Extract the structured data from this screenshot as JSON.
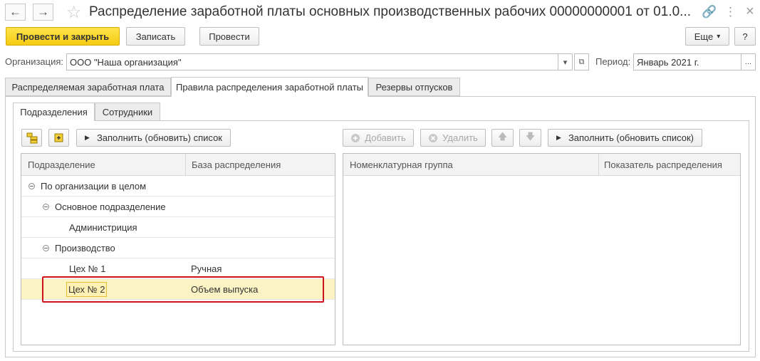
{
  "window": {
    "title": "Распределение заработной платы основных производственных рабочих 00000000001 от 01.0...",
    "back_icon": "←",
    "forward_icon": "→",
    "star_icon": "☆",
    "link_icon": "🔗",
    "more_icon": "⋮",
    "close_icon": "×"
  },
  "toolbar": {
    "post_close": "Провести и закрыть",
    "save": "Записать",
    "post": "Провести",
    "more": "Еще",
    "more_arrow": "▾",
    "help": "?"
  },
  "organization": {
    "label": "Организация:",
    "value": "ООО \"Наша организация\"",
    "dropdown": "▾",
    "open_icon": "⧉"
  },
  "period": {
    "label": "Период:",
    "value": "Январь 2021 г.",
    "select": "..."
  },
  "tabs": [
    "Распределяемая заработная плата",
    "Правила распределения заработной платы",
    "Резервы отпусков"
  ],
  "subtabs": [
    "Подразделения",
    "Сотрудники"
  ],
  "left_panel": {
    "fill_button": "Заполнить (обновить) список",
    "columns": [
      "Подразделение",
      "База распределения"
    ],
    "rows": [
      {
        "name": "По организации в целом",
        "base": ""
      },
      {
        "name": "Основное подразделение",
        "base": ""
      },
      {
        "name": "Администриция",
        "base": ""
      },
      {
        "name": "Производство",
        "base": ""
      },
      {
        "name": "Цех № 1",
        "base": "Ручная"
      },
      {
        "name": "Цех № 2",
        "base": "Объем выпуска"
      }
    ]
  },
  "right_panel": {
    "add_button": "Добавить",
    "delete_button": "Удалить",
    "up_icon": "🡅",
    "down_icon": "🡇",
    "fill_button": "Заполнить (обновить список)",
    "columns": [
      "Номенклатурная группа",
      "Показатель распределения"
    ]
  },
  "colors": {
    "primary_button": "#f5cc12",
    "selected_row": "#fcf3c5",
    "highlight_frame": "#d0121b"
  }
}
